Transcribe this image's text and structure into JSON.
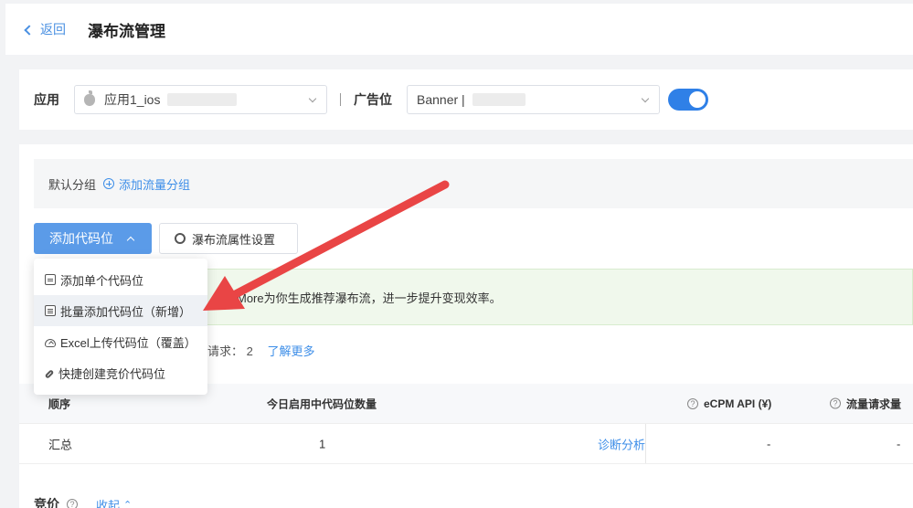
{
  "header": {
    "back_label": "返回",
    "title": "瀑布流管理"
  },
  "filters": {
    "app_label": "应用",
    "app_value": "应用1_ios",
    "slot_label": "广告位",
    "slot_value": "Banner |"
  },
  "group_bar": {
    "default_group": "默认分组",
    "add_group": "添加流量分组"
  },
  "toolbar": {
    "add_slot": "添加代码位",
    "settings": "瀑布流属性设置"
  },
  "tip": {
    "text": "More为你生成推荐瀑布流，进一步提升变现效率。"
  },
  "requests": {
    "label": "请求：",
    "count": "2",
    "learn_more": "了解更多"
  },
  "table": {
    "headers": {
      "order": "顺序",
      "count": "今日启用中代码位数量",
      "ecpm": "eCPM API (¥)",
      "traffic": "流量请求量"
    },
    "row": {
      "order": "汇总",
      "count": "1",
      "diagnose": "诊断分析",
      "ecpm": "-",
      "traffic": "-"
    }
  },
  "bottom": {
    "title": "竞价",
    "help": "?",
    "fold": "收起"
  },
  "dropdown": {
    "items": [
      {
        "label": "添加单个代码位",
        "icon": "document-icon"
      },
      {
        "label": "批量添加代码位（新增）",
        "icon": "documents-icon"
      },
      {
        "label": "Excel上传代码位（覆盖）",
        "icon": "cloud-upload-icon"
      },
      {
        "label": "快捷创建竞价代码位",
        "icon": "link-icon"
      }
    ],
    "active_index": 1
  },
  "colors": {
    "primary": "#5b9be8",
    "link": "#3d8ee8",
    "toggle": "#2f80e7",
    "arrow": "#e94545",
    "tip_bg": "#f0f8ec"
  }
}
